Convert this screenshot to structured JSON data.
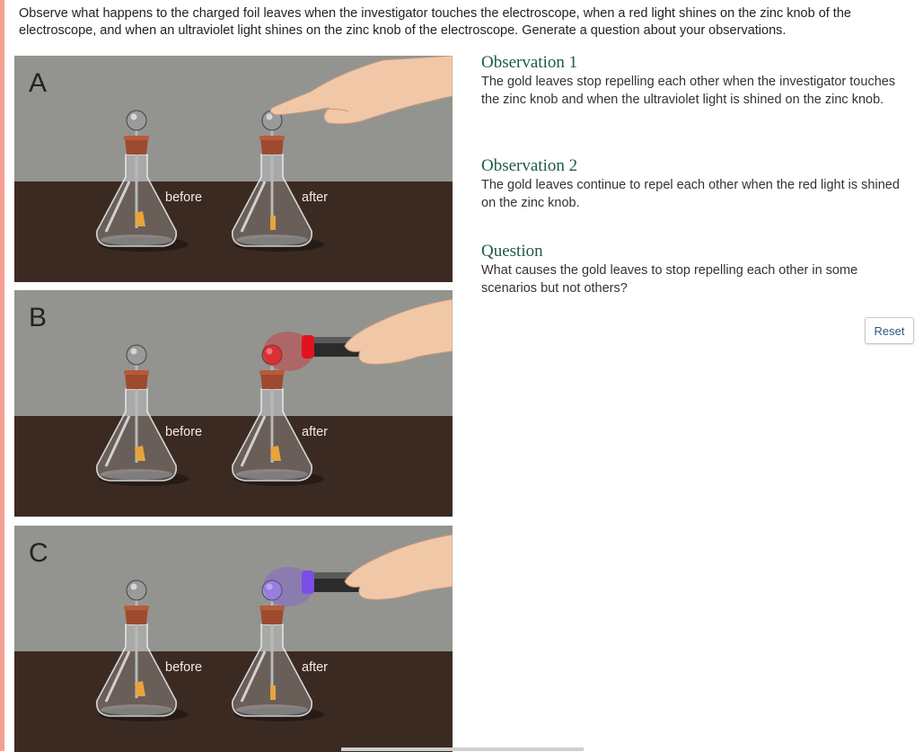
{
  "instructions": "Observe what happens to the charged foil leaves when the investigator touches the electroscope, when a red light shines on the zinc knob of the electroscope, and when an ultraviolet light shines on the zinc knob of the electroscope. Generate a question about your observations.",
  "panels": [
    {
      "letter": "A",
      "before_label": "before",
      "after_label": "after",
      "action": "finger"
    },
    {
      "letter": "B",
      "before_label": "before",
      "after_label": "after",
      "action": "red-light"
    },
    {
      "letter": "C",
      "before_label": "before",
      "after_label": "after",
      "action": "ultraviolet-light"
    }
  ],
  "observations": [
    {
      "title": "Observation 1",
      "text": "The gold leaves stop repelling each other when the investigator touches the zinc knob and when the ultraviolet light is shined on the zinc knob."
    },
    {
      "title": "Observation 2",
      "text": "The gold leaves continue to repel each other when the red light is shined on the zinc knob."
    }
  ],
  "question": {
    "title": "Question",
    "text": "What causes the gold leaves to stop repelling each other in some scenarios but not others?"
  },
  "reset_label": "Reset",
  "colors": {
    "heading": "#1d5b3f",
    "accent": "#f4a090",
    "wall": "#8e908a",
    "table": "#3b2a21",
    "red_light": "#e0141e",
    "uv_light": "#7a4fe8"
  }
}
